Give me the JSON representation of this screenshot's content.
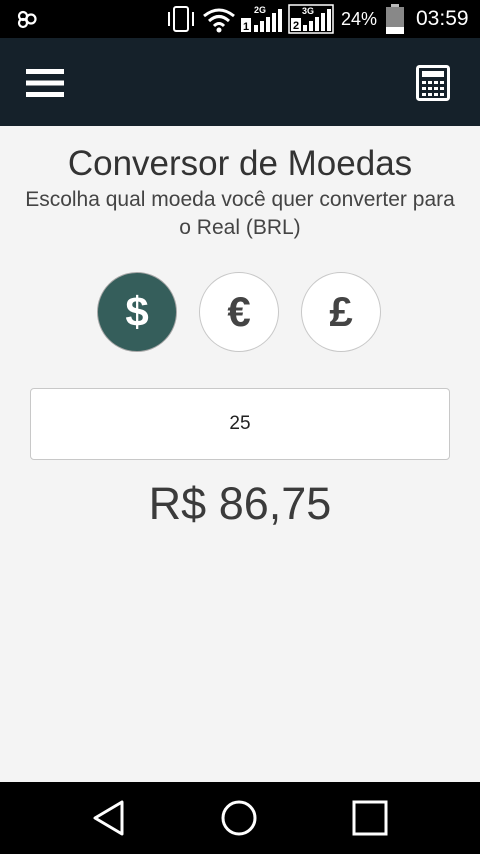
{
  "status_bar": {
    "battery_percent": "24%",
    "time": "03:59",
    "sim1_network": "2G",
    "sim1_slot": "1",
    "sim2_network": "3G",
    "sim2_slot": "2"
  },
  "app_bar": {
    "menu_icon": "hamburger-menu-icon",
    "action_icon": "calculator-icon",
    "background_color": "#15212a"
  },
  "main": {
    "title": "Conversor de Moedas",
    "subtitle": "Escolha qual moeda você quer converter para o Real (BRL)",
    "currencies": [
      {
        "symbol": "$",
        "selected": true
      },
      {
        "symbol": "€",
        "selected": false
      },
      {
        "symbol": "£",
        "selected": false
      }
    ],
    "amount_value": "25",
    "result": "R$ 86,75",
    "accent_color": "#355e5b"
  },
  "nav_bar": {
    "back_icon": "back-triangle-icon",
    "home_icon": "home-circle-icon",
    "recents_icon": "recents-square-icon"
  }
}
